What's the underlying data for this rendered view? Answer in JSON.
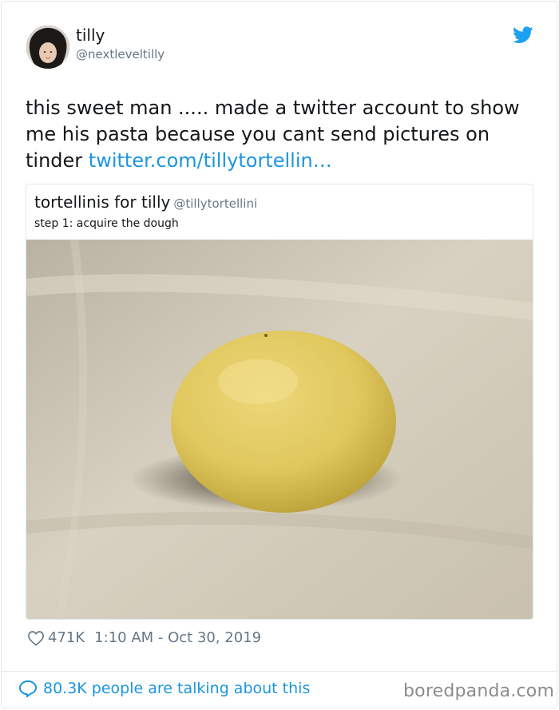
{
  "author": {
    "display_name": "tilly",
    "handle": "@nextleveltilly",
    "avatar_icon": "profile-photo-avatar"
  },
  "tweet": {
    "text": "this sweet man ..... made a twitter account to show me his pasta because you cant send pictures on tinder",
    "link": "twitter.com/tillytortellin…"
  },
  "quoted_tweet": {
    "display_name": "tortellinis for tilly",
    "handle": "@tillytortellini",
    "text": "step 1: acquire the dough",
    "image_icon": "dough-ball-photo"
  },
  "meta": {
    "likes": "471K",
    "timestamp": "1:10 AM - Oct 30, 2019",
    "heart_icon": "heart-icon"
  },
  "footer": {
    "talking": "80.3K people are talking about this",
    "bubble_icon": "chat-bubble-icon",
    "watermark": "boredpanda.com"
  },
  "colors": {
    "link": "#1b95e0",
    "secondary_text": "#657786",
    "twitter_bird": "#1da1f2",
    "border": "#e1e8ed"
  }
}
